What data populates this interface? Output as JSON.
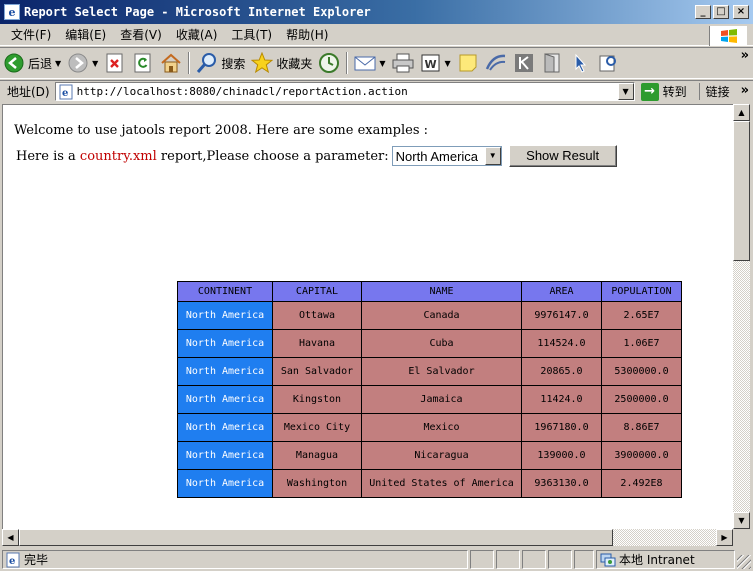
{
  "window": {
    "title": "Report Select Page - Microsoft Internet Explorer",
    "app_icon": "ie-page-icon",
    "buttons": {
      "minimize": "_",
      "maximize": "□",
      "close": "×"
    }
  },
  "menu": [
    {
      "label": "文件(F)"
    },
    {
      "label": "编辑(E)"
    },
    {
      "label": "查看(V)"
    },
    {
      "label": "收藏(A)"
    },
    {
      "label": "工具(T)"
    },
    {
      "label": "帮助(H)"
    }
  ],
  "toolbar": {
    "back_label": "后退",
    "search_label": "搜索",
    "favorites_label": "收藏夹",
    "more": "»"
  },
  "address": {
    "label": "地址(D)",
    "url": "http://localhost:8080/chinadcl/reportAction.action",
    "go_label": "转到",
    "links_label": "链接",
    "more": "»"
  },
  "page": {
    "welcome": "Welcome to use jatools report 2008. Here are some examples :",
    "prefix": "Here is a ",
    "link": "country.xml",
    "suffix": " report,Please choose a parameter:",
    "select_value": "North America",
    "button_label": "Show Result"
  },
  "table": {
    "headers": [
      "CONTINENT",
      "CAPITAL",
      "NAME",
      "AREA",
      "POPULATION"
    ],
    "rows": [
      [
        "North America",
        "Ottawa",
        "Canada",
        "9976147.0",
        "2.65E7"
      ],
      [
        "North America",
        "Havana",
        "Cuba",
        "114524.0",
        "1.06E7"
      ],
      [
        "North America",
        "San Salvador",
        "El Salvador",
        "20865.0",
        "5300000.0"
      ],
      [
        "North America",
        "Kingston",
        "Jamaica",
        "11424.0",
        "2500000.0"
      ],
      [
        "North America",
        "Mexico City",
        "Mexico",
        "1967180.0",
        "8.86E7"
      ],
      [
        "North America",
        "Managua",
        "Nicaragua",
        "139000.0",
        "3900000.0"
      ],
      [
        "North America",
        "Washington",
        "United States of America",
        "9363130.0",
        "2.492E8"
      ]
    ]
  },
  "status": {
    "text": "完毕",
    "zone": "本地 Intranet"
  },
  "colors": {
    "header_bg": "#7777ee",
    "continent_bg": "#1f7ef0",
    "cell_bg": "#c27f7f",
    "link": "#c00000",
    "titlebar": "#0a246a"
  }
}
